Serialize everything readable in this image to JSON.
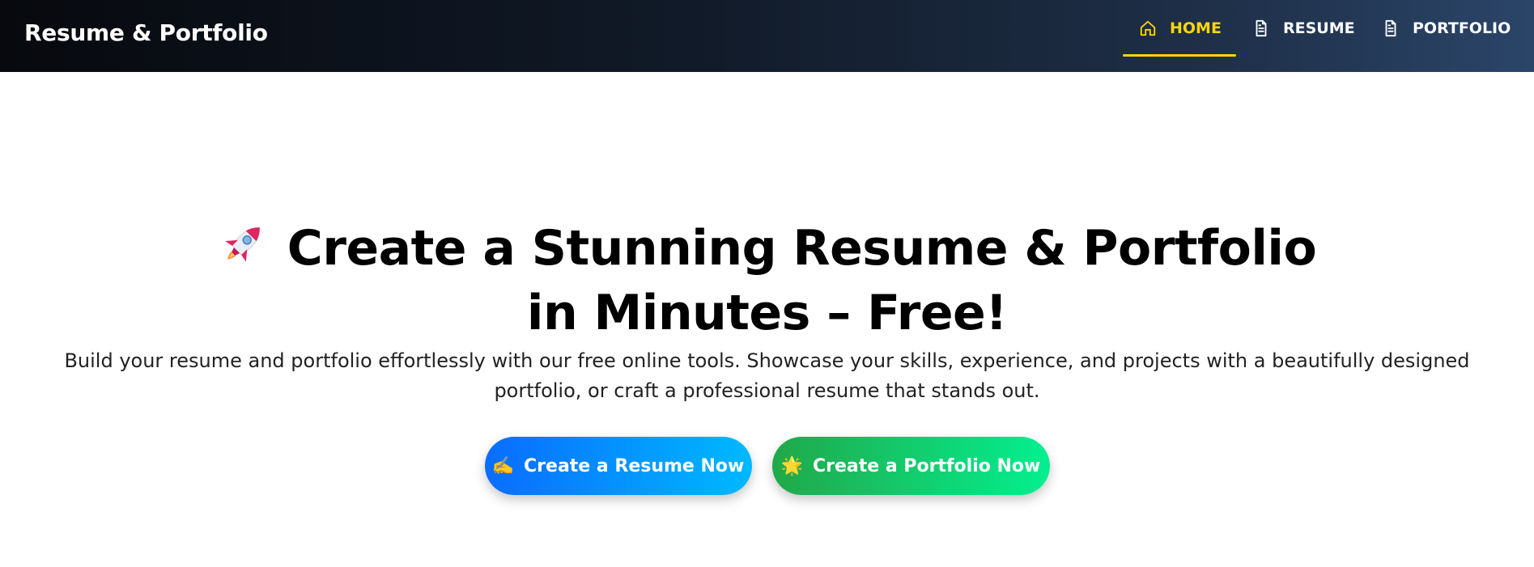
{
  "brand": {
    "title": "Resume & Portfolio"
  },
  "nav": {
    "items": [
      {
        "label": "HOME",
        "icon": "home-icon",
        "active": true
      },
      {
        "label": "RESUME",
        "icon": "document-icon",
        "active": false
      },
      {
        "label": "PORTFOLIO",
        "icon": "document-icon",
        "active": false
      }
    ],
    "active_color": "#ffd60a"
  },
  "hero": {
    "title_line1": "Create a Stunning Resume & Portfolio",
    "title_line2": "in Minutes – Free!",
    "rocket_icon": "rocket-icon",
    "description": "Build your resume and portfolio effortlessly with our free online tools. Showcase your skills, experience, and projects with a beautifully designed portfolio, or craft a professional resume that stands out.",
    "cta_resume": {
      "emoji": "✍️",
      "label": "Create a Resume Now",
      "color": "#0a6cff"
    },
    "cta_portfolio": {
      "emoji": "🌟",
      "label": "Create a Portfolio Now",
      "color": "#21a84a"
    }
  }
}
